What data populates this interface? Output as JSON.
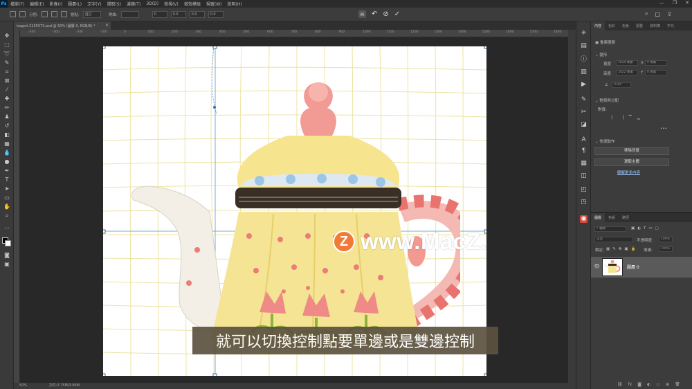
{
  "app": {
    "logo": "Ps",
    "menu": [
      "檔案(F)",
      "編輯(E)",
      "影像(I)",
      "圖層(L)",
      "文字(Y)",
      "選取(S)",
      "濾鏡(T)",
      "3D(D)",
      "檢視(V)",
      "增效模組",
      "視窗(W)",
      "說明(H)"
    ],
    "window_controls": [
      "—",
      "❐",
      "✕"
    ]
  },
  "options_bar": {
    "split_label": "分割:",
    "grid_label": "格點:",
    "grid_value": "自訂",
    "fields": [
      "0",
      "0.0",
      "0.0",
      "0.0"
    ],
    "right_icons": [
      "puppet-warp-icon",
      "undo-icon",
      "cancel-icon",
      "commit-icon"
    ]
  },
  "document_tab": {
    "title": "teapot-2155573.psd @ 50% (圖層 0, RGB/8) *",
    "close": "×"
  },
  "ruler_top_numbers": [
    "-400",
    "-300",
    "-200",
    "-100",
    "0",
    "100",
    "200",
    "300",
    "400",
    "500",
    "600",
    "700",
    "800",
    "900",
    "1000",
    "1100",
    "1200",
    "1300",
    "1400",
    "1500",
    "1600",
    "1700",
    "1800"
  ],
  "status_bar": {
    "zoom": "50%",
    "info": "文件:2.75M/3.96M"
  },
  "watermark": {
    "logo_letter": "Z",
    "text": "www.MacZ.com"
  },
  "subtitle": "就可以切換控制點要單邊或是雙邊控制",
  "properties_panel": {
    "tabs": [
      "內容",
      "色彩",
      "色板",
      "調整",
      "資料庫",
      "字元"
    ],
    "pixel_layer": "像素圖層",
    "transform_heading": "變形",
    "w_label": "寬度",
    "w_value": "1024 像素",
    "h_label": "高度",
    "h_value": "1022 像素",
    "x_value": "0 像素",
    "y_value": "0 像素",
    "angle_value": "0.00°",
    "align_heading": "對齊與分配",
    "align_sub": "對齊:",
    "quick_actions": "快速動作",
    "btn1": "移除背景",
    "btn2": "選取主體",
    "link": "瞭解更多內容"
  },
  "layers_panel": {
    "tabs": [
      "圖層",
      "色版",
      "路徑"
    ],
    "search_placeholder": "種類",
    "blend_mode": "正常",
    "opacity_label": "不透明度:",
    "opacity_value": "100%",
    "lock_label": "鎖定:",
    "fill_label": "填滿:",
    "fill_value": "100%",
    "layer_name": "圖層 0",
    "bottom_icons": [
      "link-icon",
      "fx-icon",
      "mask-icon",
      "adjustment-icon",
      "folder-icon",
      "new-layer-icon",
      "trash-icon"
    ]
  },
  "colors": {
    "menubar": "#2b2b2b",
    "panel": "#3c3c3c",
    "canvas_bg": "#282828",
    "grid_line": "#ede3a0",
    "subtitle_bg": "#5c5240",
    "watermark_logo": "#f37a36"
  }
}
